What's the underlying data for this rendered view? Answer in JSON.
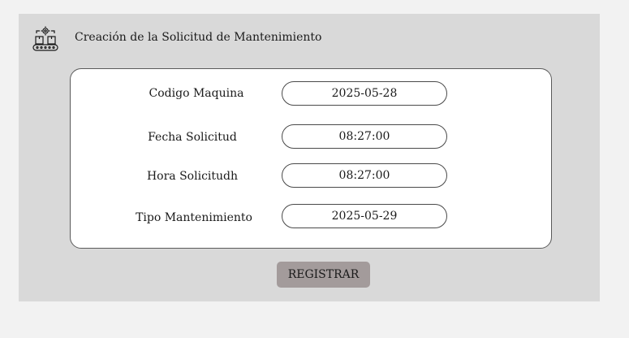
{
  "header": {
    "icon": "conveyor-gear-icon",
    "title": "Creación de la Solicitud de Mantenimiento"
  },
  "form": {
    "fields": [
      {
        "label": "Codigo Maquina",
        "value": "2025-05-28"
      },
      {
        "label": "Fecha Solicitud",
        "value": "08:27:00"
      },
      {
        "label": "Hora Solicitudh",
        "value": "08:27:00"
      },
      {
        "label": "Tipo Mantenimiento",
        "value": "2025-05-29"
      }
    ]
  },
  "actions": {
    "register_label": "REGISTRAR"
  },
  "colors": {
    "page_background": "#f2f2f2",
    "panel_background": "#d9d9d9",
    "card_background": "#ffffff",
    "button_background": "#a39b9b"
  }
}
